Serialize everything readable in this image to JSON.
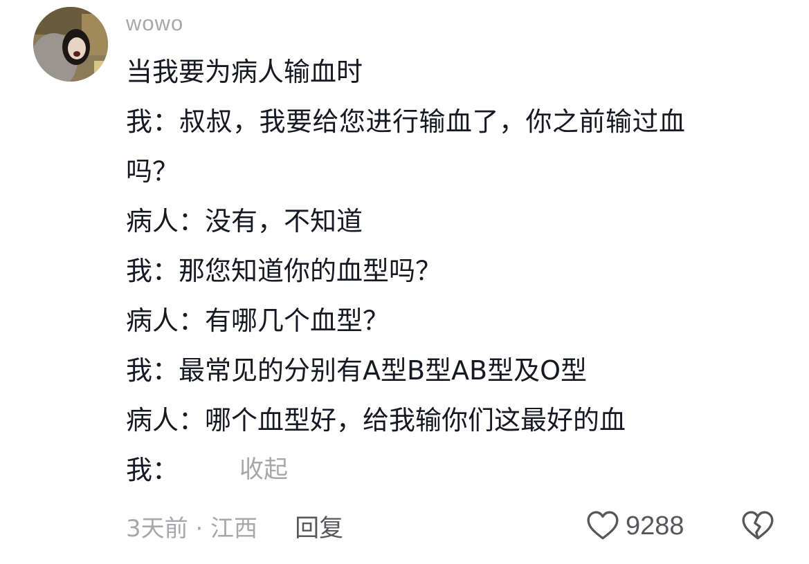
{
  "comment": {
    "username": "wowo",
    "lines": [
      "当我要为病人输血时",
      "我：叔叔，我要给您进行输血了，你之前输过血",
      "吗？",
      "病人：没有，不知道",
      "我：那您知道你的血型吗？",
      "病人：有哪几个血型？",
      "我：最常见的分别有A型B型AB型及O型",
      "病人：哪个血型好，给我输你们这最好的血"
    ],
    "last_line_prefix": "我：",
    "collapse_label": "收起",
    "meta": "3天前 · 江西",
    "reply_label": "回复",
    "like_count": "9288",
    "icons": {
      "like": "heart-outline-icon",
      "dislike": "broken-heart-icon"
    }
  }
}
